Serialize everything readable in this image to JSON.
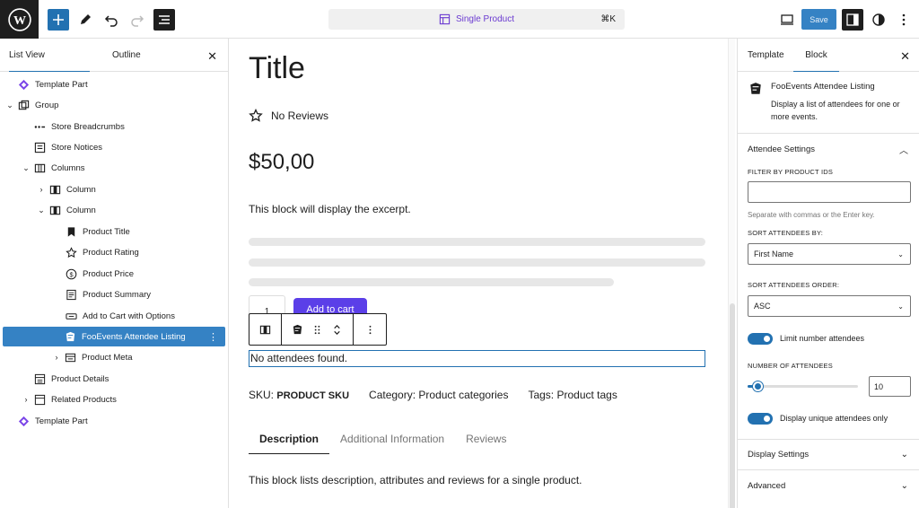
{
  "topbar": {
    "command_label": "Single Product",
    "command_shortcut": "⌘K",
    "save_label": "Save"
  },
  "left": {
    "tabs": [
      "List View",
      "Outline"
    ],
    "close_glyph": "✕",
    "tree": [
      {
        "label": "Template Part",
        "icon": "template-part-icon"
      },
      {
        "label": "Group",
        "icon": "group-icon"
      },
      {
        "label": "Store Breadcrumbs",
        "icon": "breadcrumbs-icon"
      },
      {
        "label": "Store Notices",
        "icon": "notices-icon"
      },
      {
        "label": "Columns",
        "icon": "columns-icon"
      },
      {
        "label": "Column",
        "icon": "column-icon"
      },
      {
        "label": "Column",
        "icon": "column-icon"
      },
      {
        "label": "Product Title",
        "icon": "bookmark-icon"
      },
      {
        "label": "Product Rating",
        "icon": "star-icon"
      },
      {
        "label": "Product Price",
        "icon": "dollar-icon"
      },
      {
        "label": "Product Summary",
        "icon": "summary-icon"
      },
      {
        "label": "Add to Cart with Options",
        "icon": "button-icon"
      },
      {
        "label": "FooEvents Attendee Listing",
        "icon": "fooevents-icon"
      },
      {
        "label": "Product Meta",
        "icon": "meta-icon"
      },
      {
        "label": "Product Details",
        "icon": "details-icon"
      },
      {
        "label": "Related Products",
        "icon": "related-icon"
      },
      {
        "label": "Template Part",
        "icon": "template-part-icon"
      }
    ]
  },
  "canvas": {
    "title": "Title",
    "rating": "No Reviews",
    "price": "$50,00",
    "excerpt": "This block will display the excerpt.",
    "qty": "1",
    "add_to_cart": "Add to cart",
    "no_attendees": "No attendees found.",
    "sku_label": "SKU:",
    "sku_value": "PRODUCT SKU",
    "category": "Category: Product categories",
    "tags": "Tags: Product tags",
    "tabs": [
      "Description",
      "Additional Information",
      "Reviews"
    ],
    "description": "This block lists description, attributes and reviews for a single product."
  },
  "right": {
    "tabs": [
      "Template",
      "Block"
    ],
    "close_glyph": "✕",
    "block_name": "FooEvents Attendee Listing",
    "block_desc": "Display a list of attendees for one or more events.",
    "attendee_settings": "Attendee Settings",
    "filter_label": "FILTER BY PRODUCT IDS",
    "filter_value": "",
    "filter_help": "Separate with commas or the Enter key.",
    "sort_by_label": "SORT ATTENDEES BY:",
    "sort_by_value": "First Name",
    "sort_order_label": "SORT ATTENDEES ORDER:",
    "sort_order_value": "ASC",
    "limit_toggle_label": "Limit number attendees",
    "limit_toggle_on": true,
    "number_label": "NUMBER OF ATTENDEES",
    "number_value": "10",
    "unique_toggle_label": "Display unique attendees only",
    "unique_toggle_on": true,
    "display_settings": "Display Settings",
    "advanced": "Advanced"
  },
  "colors": {
    "accent": "#2271b1",
    "selection": "#3582c4",
    "add_to_cart": "#5b3fe8",
    "command_text": "#6b3bd1"
  }
}
